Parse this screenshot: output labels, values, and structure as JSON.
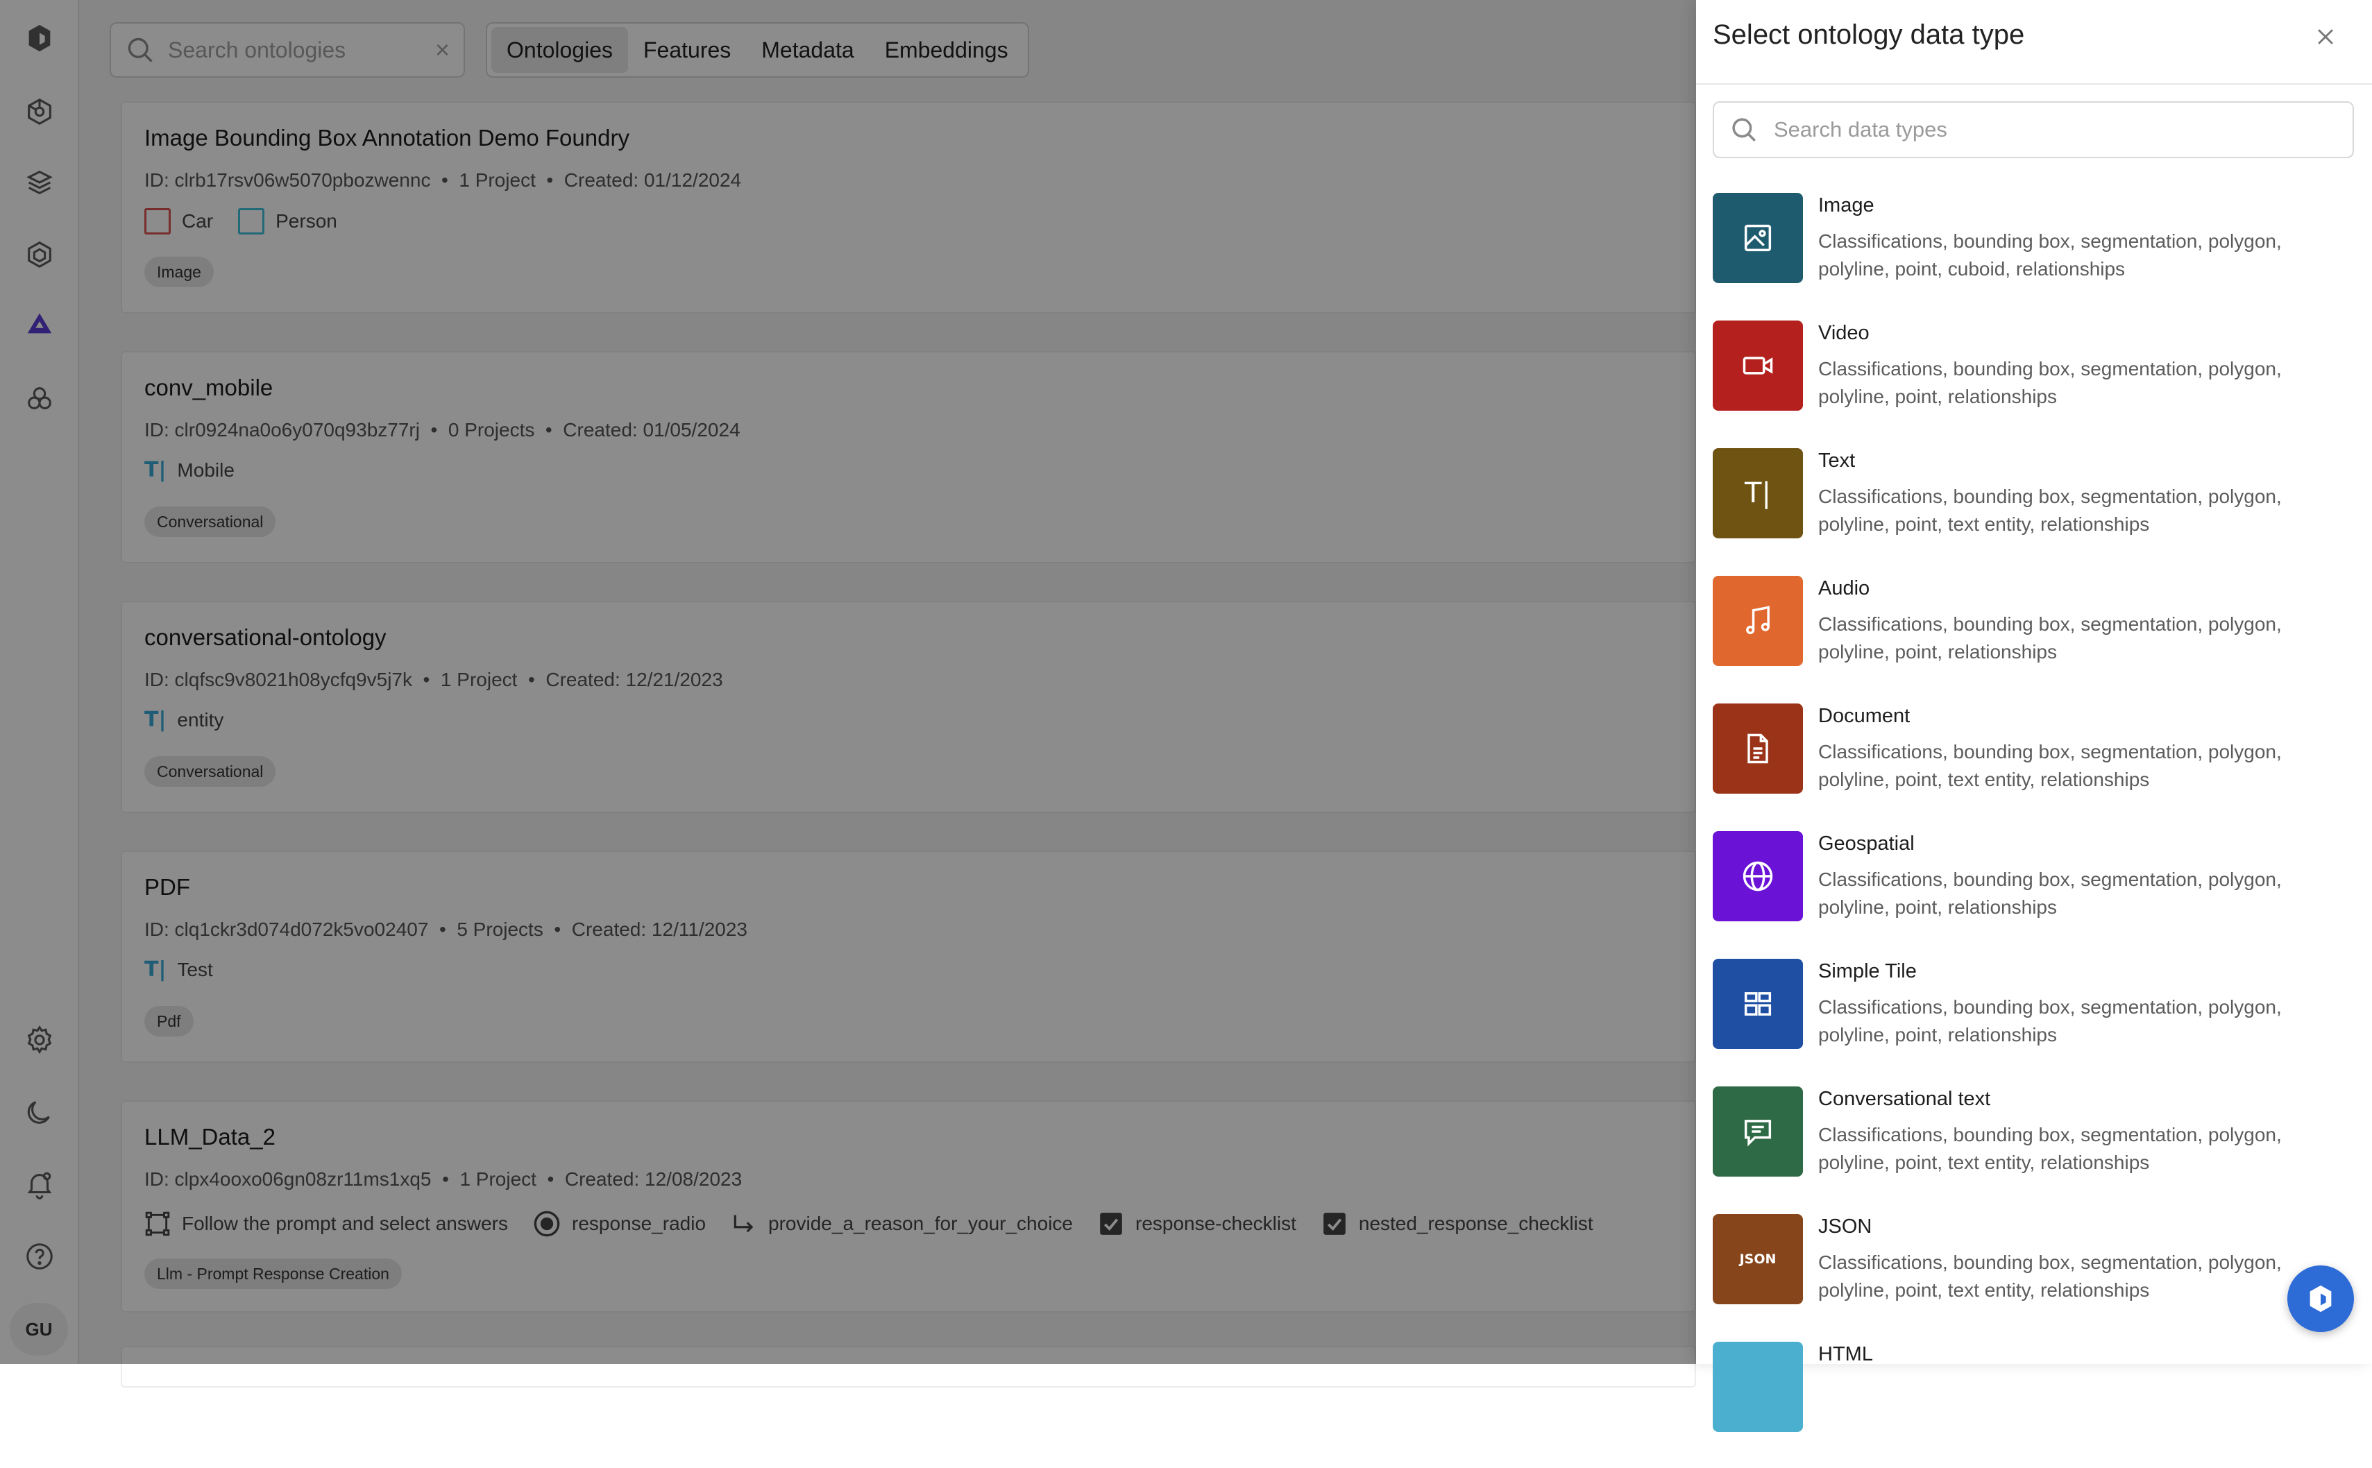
{
  "rail": {
    "avatar": "GU"
  },
  "toolbar": {
    "search_placeholder": "Search ontologies",
    "clear": "×",
    "tabs": [
      {
        "label": "Ontologies",
        "active": true
      },
      {
        "label": "Features"
      },
      {
        "label": "Metadata"
      },
      {
        "label": "Embeddings"
      }
    ]
  },
  "ontologies": [
    {
      "title": "Image Bounding Box Annotation Demo Foundry",
      "id": "ID: clrb17rsv06w5070pbozwennc",
      "projects": "1 Project",
      "created": "Created: 01/12/2024",
      "features": [
        {
          "label": "Car",
          "color": "#d9534f"
        },
        {
          "label": "Person",
          "color": "#3fc1d9"
        }
      ],
      "badge": "Image"
    },
    {
      "title": "conv_mobile",
      "id": "ID: clr0924na0o6y070q93bz77rj",
      "projects": "0 Projects",
      "created": "Created: 01/05/2024",
      "features": [
        {
          "label": "Mobile"
        }
      ],
      "badge": "Conversational"
    },
    {
      "title": "conversational-ontology",
      "id": "ID: clqfsc9v8021h08ycfq9v5j7k",
      "projects": "1 Project",
      "created": "Created: 12/21/2023",
      "features": [
        {
          "label": "entity"
        }
      ],
      "badge": "Conversational"
    },
    {
      "title": "PDF",
      "id": "ID: clq1ckr3d074d072k5vo02407",
      "projects": "5 Projects",
      "created": "Created: 12/11/2023",
      "features": [
        {
          "label": "Test"
        }
      ],
      "badge": "Pdf"
    },
    {
      "title": "LLM_Data_2",
      "id": "ID: clpx4ooxo06gn08zr11ms1xq5",
      "projects": "1 Project",
      "created": "Created: 12/08/2023",
      "features": [
        {
          "label": "Follow the prompt and select answers"
        },
        {
          "label": "response_radio"
        },
        {
          "label": "provide_a_reason_for_your_choice"
        },
        {
          "label": "response-checklist"
        },
        {
          "label": "nested_response_checklist"
        }
      ],
      "badge": "Llm - Prompt Response Creation"
    }
  ],
  "panel": {
    "title": "Select ontology data type",
    "search_placeholder": "Search data types",
    "types": [
      {
        "name": "Image",
        "desc": "Classifications, bounding box, segmentation, polygon, polyline, point, cuboid, relationships",
        "color": "#1f5b6e",
        "icon": "image-icon"
      },
      {
        "name": "Video",
        "desc": "Classifications, bounding box, segmentation, polygon, polyline, point, relationships",
        "color": "#b3201e",
        "icon": "video-icon"
      },
      {
        "name": "Text",
        "desc": "Classifications, bounding box, segmentation, polygon, polyline, point, text entity, relationships",
        "color": "#6e5313",
        "icon": "text-icon"
      },
      {
        "name": "Audio",
        "desc": "Classifications, bounding box, segmentation, polygon, polyline, point, relationships",
        "color": "#e0672d",
        "icon": "music-icon"
      },
      {
        "name": "Document",
        "desc": "Classifications, bounding box, segmentation, polygon, polyline, point, text entity, relationships",
        "color": "#9a3318",
        "icon": "document-icon"
      },
      {
        "name": "Geospatial",
        "desc": "Classifications, bounding box, segmentation, polygon, polyline, point, relationships",
        "color": "#6a12d6",
        "icon": "globe-icon"
      },
      {
        "name": "Simple Tile",
        "desc": "Classifications, bounding box, segmentation, polygon, polyline, point, relationships",
        "color": "#1f4fa3",
        "icon": "tiles-icon"
      },
      {
        "name": "Conversational text",
        "desc": "Classifications, bounding box, segmentation, polygon, polyline, point, text entity, relationships",
        "color": "#2d6a45",
        "icon": "chat-icon"
      },
      {
        "name": "JSON",
        "desc": "Classifications, bounding box, segmentation, polygon, polyline, point, text entity, relationships",
        "color": "#86451b",
        "icon": "json-icon",
        "tile_text": "JSON"
      },
      {
        "name": "HTML",
        "desc": "",
        "color": "#4bb0cf",
        "icon": "html-icon"
      }
    ]
  }
}
